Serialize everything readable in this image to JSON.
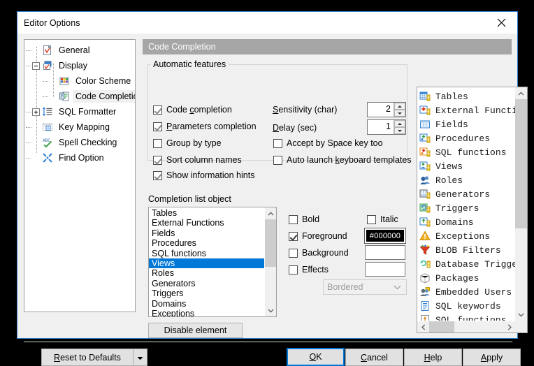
{
  "window": {
    "title": "Editor Options",
    "close_icon": "close-icon"
  },
  "tree": {
    "items": [
      {
        "label": "General",
        "icon": "general-page-icon",
        "level": 1,
        "expander": "none"
      },
      {
        "label": "Display",
        "icon": "display-page-icon",
        "level": 1,
        "expander": "minus"
      },
      {
        "label": "Color Scheme",
        "icon": "color-scheme-icon",
        "level": 2,
        "expander": "none"
      },
      {
        "label": "Code Completion",
        "icon": "code-completion-icon",
        "level": 2,
        "expander": "none",
        "selected": true
      },
      {
        "label": "SQL Formatter",
        "icon": "sql-formatter-icon",
        "level": 1,
        "expander": "plus"
      },
      {
        "label": "Key Mapping",
        "icon": "key-mapping-icon",
        "level": 1,
        "expander": "none"
      },
      {
        "label": "Spell Checking",
        "icon": "spell-checking-icon",
        "level": 1,
        "expander": "none"
      },
      {
        "label": "Find Option",
        "icon": "find-option-icon",
        "level": 1,
        "expander": "none"
      }
    ]
  },
  "header": {
    "title": "Code Completion"
  },
  "automatic_features": {
    "group_title": "Automatic features",
    "checkboxes": [
      {
        "label_pre": "Code ",
        "label_accel": "c",
        "label_post": "ompletion",
        "checked": true
      },
      {
        "label_pre": "",
        "label_accel": "P",
        "label_post": "arameters completion",
        "checked": true
      },
      {
        "label_pre": "Group by type",
        "label_accel": "",
        "label_post": "",
        "checked": false
      },
      {
        "label_pre": "Sort column names",
        "label_accel": "",
        "label_post": "",
        "checked": true
      },
      {
        "label_pre": "Show information hints",
        "label_accel": "",
        "label_post": "",
        "checked": true
      },
      {
        "label_pre": "Accept by Space key too",
        "label_accel": "",
        "label_post": "",
        "checked": false
      },
      {
        "label_pre": "Auto launch ",
        "label_accel": "k",
        "label_post": "eyboard templates",
        "checked": false
      }
    ],
    "sensitivity_label_pre": "",
    "sensitivity_label_accel": "S",
    "sensitivity_label_post": "ensitivity (char)",
    "sensitivity_value": "2",
    "delay_label_pre": "",
    "delay_label_accel": "D",
    "delay_label_post": "elay (sec)",
    "delay_value": "1"
  },
  "completion_list": {
    "section_label": "Completion list object",
    "items": [
      "Tables",
      "External Functions",
      "Fields",
      "Procedures",
      "SQL functions",
      "Views",
      "Roles",
      "Generators",
      "Triggers",
      "Domains",
      "Exceptions"
    ],
    "selected": "Views",
    "disable_button": "Disable element"
  },
  "style_options": {
    "bold_label": "Bold",
    "bold_checked": false,
    "italic_label": "Italic",
    "italic_checked": false,
    "foreground_label": "Foreground",
    "foreground_checked": true,
    "foreground_color": "#000000",
    "background_label": "Background",
    "background_checked": false,
    "background_color": "",
    "effects_label": "Effects",
    "effects_checked": false,
    "effects_color": "",
    "effects_combo_value": "Bordered"
  },
  "preview_list": {
    "items": [
      {
        "label": "Tables",
        "icon": "table-icon"
      },
      {
        "label": "External Functi",
        "icon": "external-function-icon"
      },
      {
        "label": "Fields",
        "icon": "field-icon"
      },
      {
        "label": "Procedures",
        "icon": "procedure-icon"
      },
      {
        "label": "SQL functions",
        "icon": "sql-function-icon"
      },
      {
        "label": "Views",
        "icon": "view-icon"
      },
      {
        "label": "Roles",
        "icon": "role-icon"
      },
      {
        "label": "Generators",
        "icon": "generator-icon"
      },
      {
        "label": "Triggers",
        "icon": "trigger-icon"
      },
      {
        "label": "Domains",
        "icon": "domain-icon"
      },
      {
        "label": "Exceptions",
        "icon": "exception-icon"
      },
      {
        "label": "BLOB Filters",
        "icon": "blob-filter-icon"
      },
      {
        "label": "Database Trigge",
        "icon": "database-trigger-icon"
      },
      {
        "label": "Packages",
        "icon": "package-icon"
      },
      {
        "label": "Embedded Users",
        "icon": "embedded-user-icon"
      },
      {
        "label": "SQL keywords",
        "icon": "sql-keyword-icon"
      },
      {
        "label": "SQL functions",
        "icon": "sql-function2-icon"
      }
    ]
  },
  "footer": {
    "reset_pre": "",
    "reset_accel": "R",
    "reset_post": "eset to Defaults",
    "ok_pre": "",
    "ok_accel": "O",
    "ok_post": "K",
    "cancel_pre": "",
    "cancel_accel": "C",
    "cancel_post": "ancel",
    "help_pre": "",
    "help_accel": "H",
    "help_post": "elp",
    "apply_pre": "",
    "apply_accel": "A",
    "apply_post": "pply"
  },
  "colors": {
    "accent": "#0078d7",
    "header_bar": "#a6a6a6",
    "dialog_bg": "#f0f0f0"
  }
}
